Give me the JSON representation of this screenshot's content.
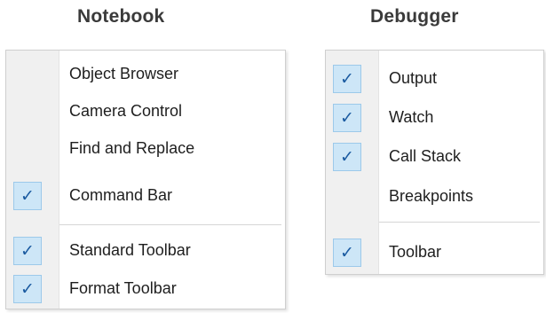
{
  "notebook": {
    "title": "Notebook",
    "items": [
      {
        "label": "Object Browser",
        "checked": false
      },
      {
        "label": "Camera Control",
        "checked": false
      },
      {
        "label": "Find and Replace",
        "checked": false
      },
      {
        "label": "Command Bar",
        "checked": true
      },
      {
        "label": "Standard Toolbar",
        "checked": true
      },
      {
        "label": "Format Toolbar",
        "checked": true
      }
    ]
  },
  "debugger": {
    "title": "Debugger",
    "items": [
      {
        "label": "Output",
        "checked": true
      },
      {
        "label": "Watch",
        "checked": true
      },
      {
        "label": "Call Stack",
        "checked": true
      },
      {
        "label": "Breakpoints",
        "checked": false
      },
      {
        "label": "Toolbar",
        "checked": true
      }
    ]
  },
  "icons": {
    "check": "check-icon",
    "check_glyph": "✓"
  },
  "colors": {
    "check_fill": "#cde6f7",
    "check_border": "#9cc9ea",
    "check_mark": "#1a5aa0",
    "gutter": "#f0f0f0"
  }
}
